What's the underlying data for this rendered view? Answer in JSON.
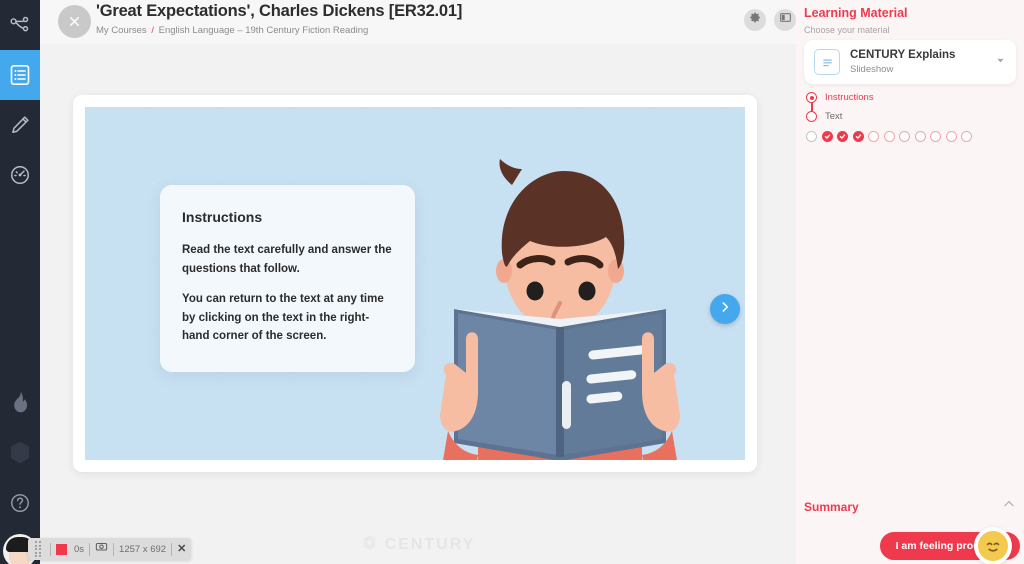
{
  "sidebar": {
    "items": [
      {
        "icon": "pathway-icon",
        "name": "sidebar-item-pathway",
        "active": false
      },
      {
        "icon": "document-icon",
        "name": "sidebar-item-study",
        "active": true
      },
      {
        "icon": "pencil-icon",
        "name": "sidebar-item-assignments",
        "active": false
      },
      {
        "icon": "gauge-icon",
        "name": "sidebar-item-progress",
        "active": false
      },
      {
        "icon": "flame-icon",
        "name": "sidebar-item-streak",
        "active": false
      },
      {
        "icon": "hexagon-icon",
        "name": "sidebar-item-rewards",
        "active": false
      },
      {
        "icon": "help-icon",
        "name": "sidebar-item-help",
        "active": false
      }
    ]
  },
  "header": {
    "close_label": "×",
    "title": "'Great Expectations', Charles Dickens [ER32.01]",
    "breadcrumb": {
      "root": "My Courses",
      "separator": "/",
      "current": "English Language – 19th Century Fiction Reading"
    },
    "actions": [
      {
        "icon": "gear-icon",
        "name": "settings-button"
      },
      {
        "icon": "panel-layout-icon",
        "name": "layout-toggle-button"
      }
    ]
  },
  "slide": {
    "instructions": {
      "heading": "Instructions",
      "paragraph1": "Read the text carefully and answer the questions that follow.",
      "paragraph2": "You can return to the text at any time by clicking on the text in the right-hand corner of the screen."
    },
    "next_label": "›",
    "watermark": "CENTURY",
    "background_color": "#c7e0f2"
  },
  "right_panel": {
    "title": "Learning Material",
    "subtitle": "Choose your material",
    "material": {
      "name": "CENTURY Explains",
      "type": "Slideshow",
      "icon": "slideshow-document-icon",
      "caret": "chevron-down-icon"
    },
    "steps": [
      {
        "label": "Instructions",
        "state": "current"
      },
      {
        "label": "Text",
        "state": "upcoming"
      }
    ],
    "progress_dots": [
      "empty-grey",
      "done",
      "done",
      "done",
      "todo",
      "todo",
      "todo",
      "todo",
      "todo",
      "todo",
      "todo"
    ],
    "summary": {
      "label": "Summary",
      "toggle_icon": "chevron-up-icon"
    },
    "feeling": {
      "label": "I am feeling proud",
      "emoji": "relieved-face"
    }
  },
  "recording_bar": {
    "grip": "drag-handle-icon",
    "stop": "stop-recording-icon",
    "time": "0s",
    "camera": "camera-icon",
    "dimensions": "1257 x 692",
    "close": "✕"
  },
  "colors": {
    "accent_red": "#ef3a4e",
    "accent_blue": "#44a8ec",
    "sidebar_bg": "#242a35",
    "panel_bg": "#fcf5f5"
  }
}
